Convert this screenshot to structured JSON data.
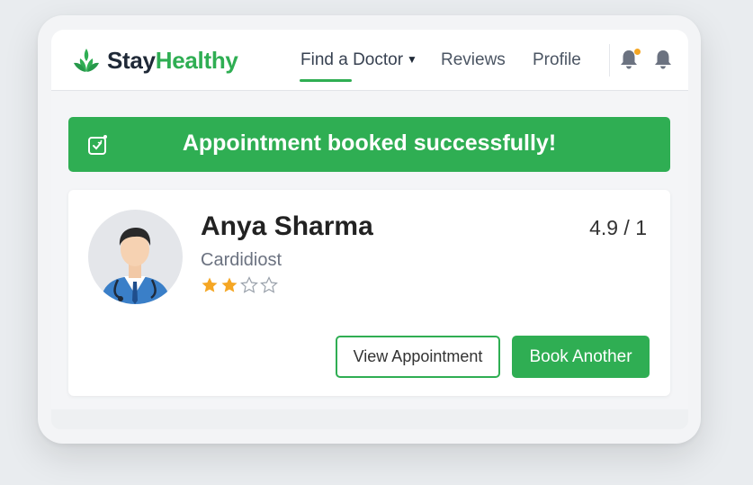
{
  "app": {
    "logo_part1": "Stay",
    "logo_part2": "Healthy",
    "brand_color": "#2fae53",
    "logo_icon": "leaf-icon"
  },
  "nav": {
    "items": [
      {
        "label": "Find a Doctor",
        "has_dropdown": true,
        "active": true
      },
      {
        "label": "Reviews"
      },
      {
        "label": "Profile"
      }
    ],
    "icons": [
      "bell-notification-icon",
      "bell-icon"
    ],
    "notification_dot_color": "#f5a623"
  },
  "banner": {
    "message": "Appointment booked successfully!",
    "icon": "calendar-check-icon"
  },
  "doctor": {
    "name": "Anya Sharma",
    "specialty": "Cardidiost",
    "stars_filled": 2,
    "stars_total": 4,
    "star_color": "#f5a623",
    "rating": "4.9 / 1",
    "avatar_icon": "doctor-avatar-icon"
  },
  "actions": {
    "view_label": "View Appointment",
    "book_label": "Book Another"
  }
}
